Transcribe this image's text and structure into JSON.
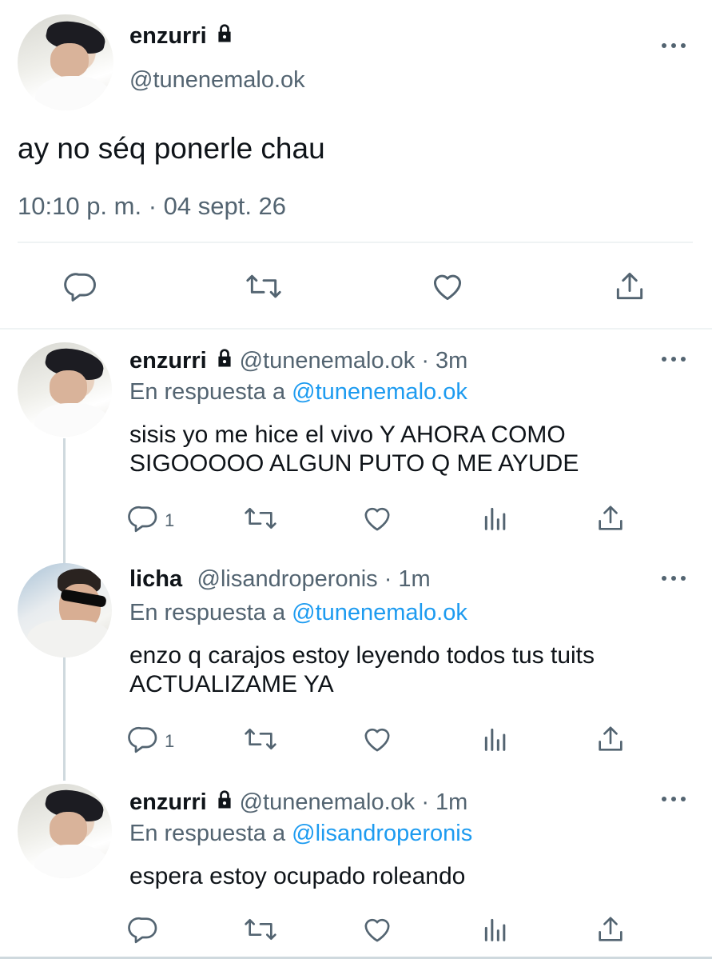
{
  "main_tweet": {
    "name": "enzurri",
    "handle": "@tunenemalo.ok",
    "text": "ay no séq ponerle chau",
    "timestamp": "10:10 p. m. · 04 sept. 26"
  },
  "replies": [
    {
      "name": "enzurri",
      "handle": "@tunenemalo.ok · 3m",
      "reply_prefix": "En respuesta a",
      "reply_to": "@tunenemalo.ok",
      "text_line1": "sisis yo me hice el vivo Y AHORA COMO",
      "text_line2": "SIGOOOOO ALGUN PUTO Q ME AYUDE",
      "reply_count": "1"
    },
    {
      "name": "licha",
      "handle": "@lisandroperonis · 1m",
      "reply_prefix": "En respuesta a",
      "reply_to": "@tunenemalo.ok",
      "text_line1": "enzo q carajos estoy leyendo todos tus tuits",
      "text_line2": "ACTUALIZAME YA",
      "reply_count": "1"
    },
    {
      "name": "enzurri",
      "handle": "@tunenemalo.ok · 1m",
      "reply_prefix": "En respuesta a",
      "reply_to": "@lisandroperonis",
      "text_line1": "espera estoy ocupado roleando",
      "reply_count": ""
    }
  ],
  "icons": [
    "lock-icon",
    "more-icon",
    "reply-icon",
    "retweet-icon",
    "like-icon",
    "share-icon",
    "views-icon"
  ],
  "colors": {
    "text": "#0f1419",
    "secondary": "#536471",
    "accent": "#1d9bf0",
    "divider": "#eff3f4"
  }
}
